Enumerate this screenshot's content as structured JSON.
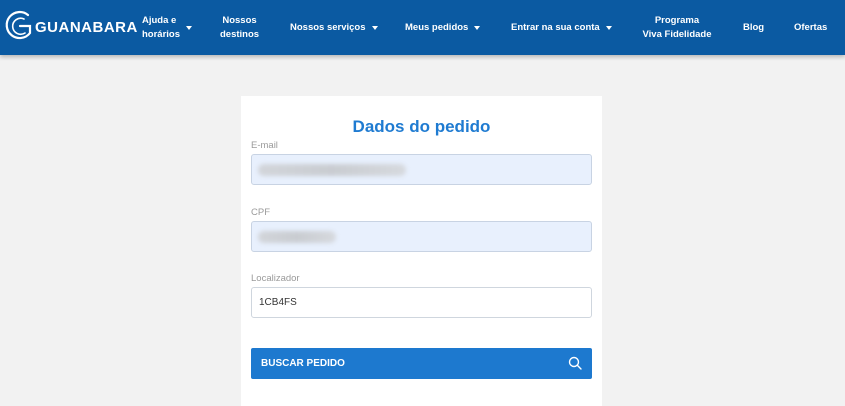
{
  "header": {
    "logo_text": "GUANABARA",
    "nav": [
      {
        "line1": "Ajuda e",
        "line2": "horários",
        "dropdown": true
      },
      {
        "line1": "Nossos",
        "line2": "destinos",
        "dropdown": false
      },
      {
        "line1": "Nossos serviços",
        "line2": "",
        "dropdown": true
      },
      {
        "line1": "Meus pedidos",
        "line2": "",
        "dropdown": true
      },
      {
        "line1": "Entrar na sua conta",
        "line2": "",
        "dropdown": true
      },
      {
        "line1": "Programa",
        "line2": "Viva Fidelidade",
        "dropdown": false
      },
      {
        "line1": "Blog",
        "line2": "",
        "dropdown": false
      },
      {
        "line1": "Ofertas",
        "line2": "",
        "dropdown": false
      }
    ]
  },
  "form": {
    "title": "Dados do pedido",
    "email": {
      "label": "E-mail",
      "value": ""
    },
    "cpf": {
      "label": "CPF",
      "value": ""
    },
    "locator": {
      "label": "Localizador",
      "value": "1CB4FS"
    },
    "submit_label": "BUSCAR PEDIDO"
  },
  "colors": {
    "header_bg": "#0b5aa2",
    "accent": "#1f7bd1",
    "button_bg": "#1d79cf",
    "page_bg": "#f2f2f2"
  },
  "icons": {
    "logo": "guanabara-g-logo",
    "dropdown": "caret-down-icon",
    "search": "search-icon"
  }
}
